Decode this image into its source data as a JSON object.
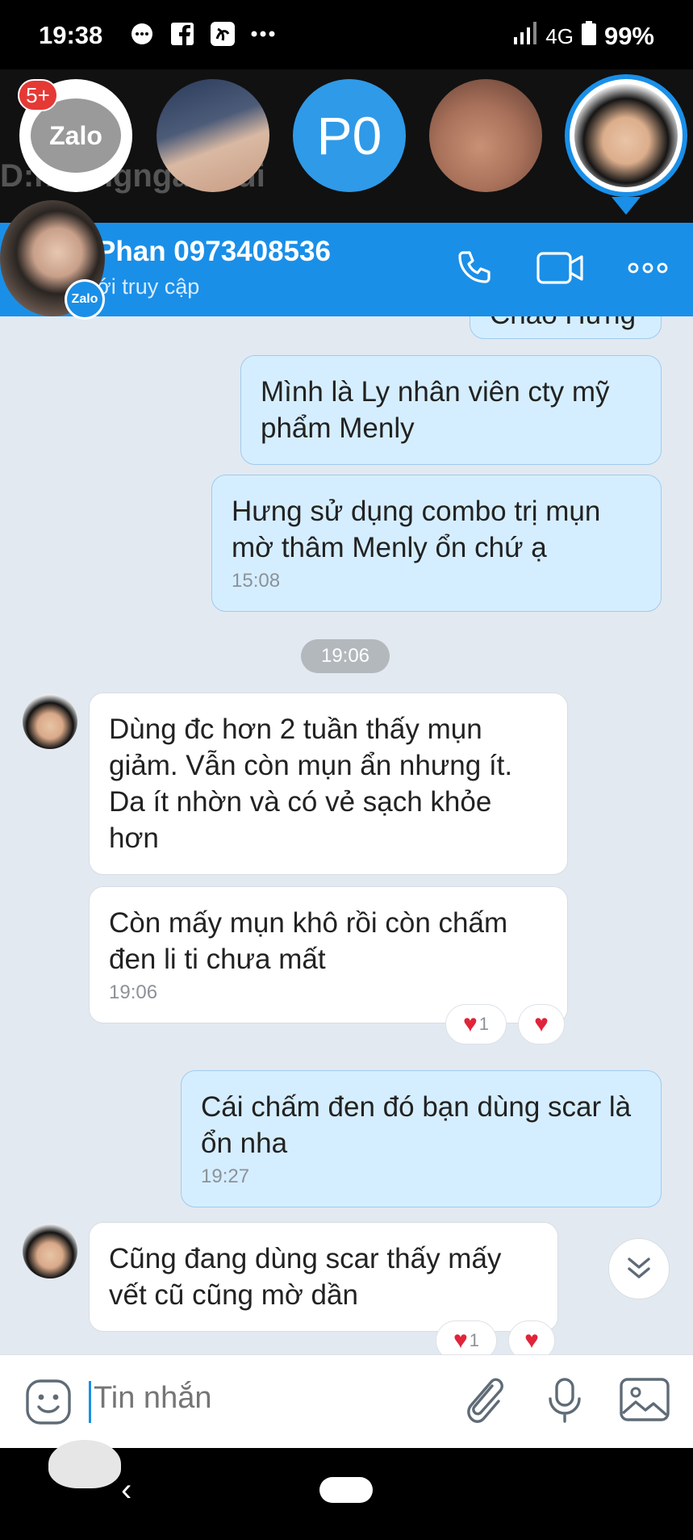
{
  "status_bar": {
    "time": "19:38",
    "network": "4G",
    "battery": "99%",
    "icons": [
      "message-icon",
      "facebook-icon",
      "app-icon",
      "more-dots-icon",
      "signal-icon",
      "battery-icon"
    ]
  },
  "chat_heads": {
    "badge": "5+",
    "zalo_label": "Zalo",
    "p0_label": "P0",
    "background_ghost_text": "D:huongngan...ui"
  },
  "header": {
    "name": "Phan 0973408536",
    "subtitle": "ới truy cập",
    "zalo_mini": "Zalo",
    "accent": "#1a8fe8"
  },
  "messages": {
    "m0": {
      "text": "Chào Hưng"
    },
    "m1": {
      "text": "Mình là Ly nhân viên cty mỹ phẩm Menly"
    },
    "m2": {
      "text": "Hưng sử dụng combo trị mụn mờ thâm Menly ổn chứ ạ",
      "time": "15:08"
    },
    "date_chip": "19:06",
    "m3": {
      "text": "Dùng đc hơn 2 tuần thấy mụn giảm. Vẫn còn mụn ẩn nhưng ít. Da ít nhờn và có vẻ sạch khỏe hơn"
    },
    "m4": {
      "text": "Còn mấy mụn khô rồi còn chấm đen li ti chưa mất",
      "time": "19:06",
      "reaction_count": "1"
    },
    "m5": {
      "text": "Cái chấm đen đó bạn dùng scar là ổn nha",
      "time": "19:27"
    },
    "m6": {
      "text": "Cũng đang dùng scar thấy mấy vết cũ cũng mờ dần",
      "reaction_count": "1"
    }
  },
  "composer": {
    "placeholder": "Tin nhắn"
  }
}
